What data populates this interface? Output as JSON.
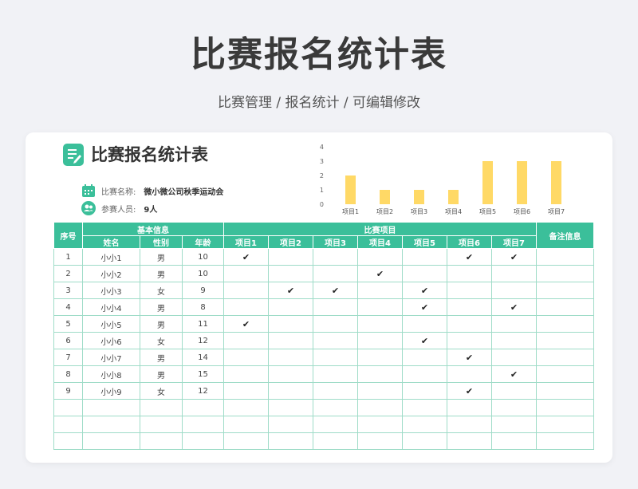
{
  "page": {
    "title": "比赛报名统计表",
    "subtitle": "比赛管理 / 报名统计 / 可编辑修改"
  },
  "sheet": {
    "title": "比赛报名统计表",
    "competition_label": "比赛名称:",
    "competition_value": "微小微公司秋季运动会",
    "participants_label": "参赛人员:",
    "participants_value": "9人"
  },
  "colors": {
    "accent": "#3bbf9a",
    "bar": "#ffd966"
  },
  "chart_data": {
    "type": "bar",
    "categories": [
      "项目1",
      "项目2",
      "项目3",
      "项目4",
      "项目5",
      "项目6",
      "项目7"
    ],
    "values": [
      2,
      1,
      1,
      1,
      3,
      3,
      3
    ],
    "ylim": [
      0,
      4
    ],
    "yticks": [
      0,
      1,
      2,
      3,
      4
    ],
    "title": "",
    "xlabel": "",
    "ylabel": "",
    "grid": false
  },
  "table": {
    "header_index": "序号",
    "header_basic": "基本信息",
    "header_events": "比赛项目",
    "header_notes": "备注信息",
    "sub_headers": [
      "姓名",
      "性别",
      "年龄"
    ],
    "event_headers": [
      "项目1",
      "项目2",
      "项目3",
      "项目4",
      "项目5",
      "项目6",
      "项目7"
    ],
    "check_mark": "✔",
    "rows": [
      {
        "idx": "1",
        "name": "小小1",
        "gender": "男",
        "age": "10",
        "events": [
          1,
          0,
          0,
          0,
          0,
          1,
          1
        ]
      },
      {
        "idx": "2",
        "name": "小小2",
        "gender": "男",
        "age": "10",
        "events": [
          0,
          0,
          0,
          1,
          0,
          0,
          0
        ]
      },
      {
        "idx": "3",
        "name": "小小3",
        "gender": "女",
        "age": "9",
        "events": [
          0,
          1,
          1,
          0,
          1,
          0,
          0
        ]
      },
      {
        "idx": "4",
        "name": "小小4",
        "gender": "男",
        "age": "8",
        "events": [
          0,
          0,
          0,
          0,
          1,
          0,
          1
        ]
      },
      {
        "idx": "5",
        "name": "小小5",
        "gender": "男",
        "age": "11",
        "events": [
          1,
          0,
          0,
          0,
          0,
          0,
          0
        ]
      },
      {
        "idx": "6",
        "name": "小小6",
        "gender": "女",
        "age": "12",
        "events": [
          0,
          0,
          0,
          0,
          1,
          0,
          0
        ]
      },
      {
        "idx": "7",
        "name": "小小7",
        "gender": "男",
        "age": "14",
        "events": [
          0,
          0,
          0,
          0,
          0,
          1,
          0
        ]
      },
      {
        "idx": "8",
        "name": "小小8",
        "gender": "男",
        "age": "15",
        "events": [
          0,
          0,
          0,
          0,
          0,
          0,
          1
        ]
      },
      {
        "idx": "9",
        "name": "小小9",
        "gender": "女",
        "age": "12",
        "events": [
          0,
          0,
          0,
          0,
          0,
          1,
          0
        ]
      }
    ],
    "empty_rows": 3
  }
}
